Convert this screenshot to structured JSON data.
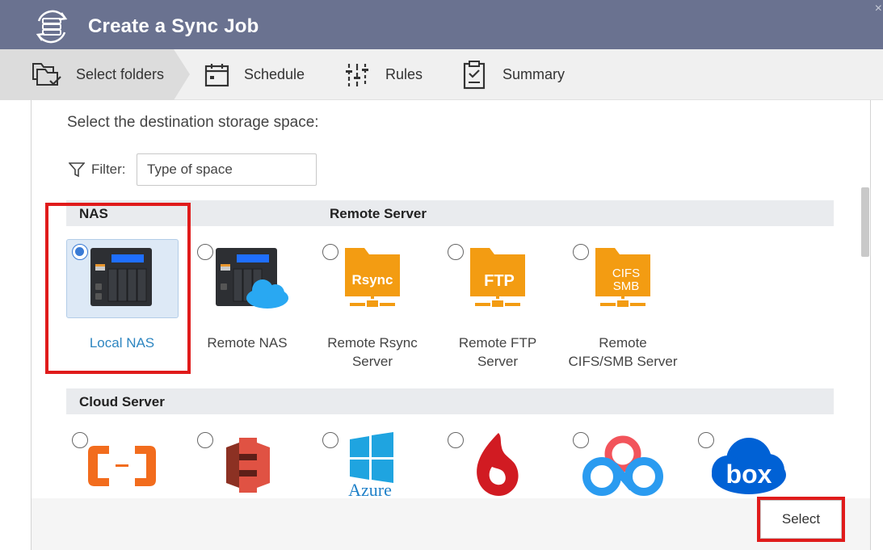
{
  "window": {
    "title": "Create a Sync Job",
    "close_glyph": "×"
  },
  "steps": [
    {
      "label": "Select folders",
      "icon": "folders-check-icon",
      "active": true
    },
    {
      "label": "Schedule",
      "icon": "calendar-icon"
    },
    {
      "label": "Rules",
      "icon": "sliders-icon"
    },
    {
      "label": "Summary",
      "icon": "clipboard-icon"
    }
  ],
  "main": {
    "heading": "Select the destination storage space:",
    "filter": {
      "label": "Filter:",
      "placeholder": "Type of space"
    },
    "sections": {
      "nas": "NAS",
      "remote_server": "Remote Server",
      "cloud_server": "Cloud Server"
    },
    "targets": [
      {
        "label": "Local NAS",
        "selected": true
      },
      {
        "label": "Remote NAS",
        "selected": false
      },
      {
        "label": "Remote Rsync Server",
        "line1": "Remote Rsync",
        "line2": "Server",
        "icon_text": "Rsync"
      },
      {
        "label": "Remote FTP Server",
        "line1": "Remote FTP",
        "line2": "Server",
        "icon_text": "FTP"
      },
      {
        "label": "Remote CIFS/SMB Server",
        "line1": "Remote",
        "line2": "CIFS/SMB Server",
        "icon_text_1": "CIFS",
        "icon_text_2": "SMB"
      }
    ],
    "cloud": [
      {
        "icon": "alibaba-cloud-icon"
      },
      {
        "icon": "amazon-s3-icon"
      },
      {
        "icon": "azure-icon",
        "text": "Azure"
      },
      {
        "icon": "backblaze-icon"
      },
      {
        "icon": "baidu-cloud-icon"
      },
      {
        "icon": "box-icon",
        "text": "box"
      }
    ]
  },
  "footer": {
    "select_label": "Select"
  },
  "colors": {
    "titlebar": "#6a7290",
    "accent": "#3a7bd5",
    "highlight": "#e01b1b",
    "folder_orange": "#f39c12"
  }
}
